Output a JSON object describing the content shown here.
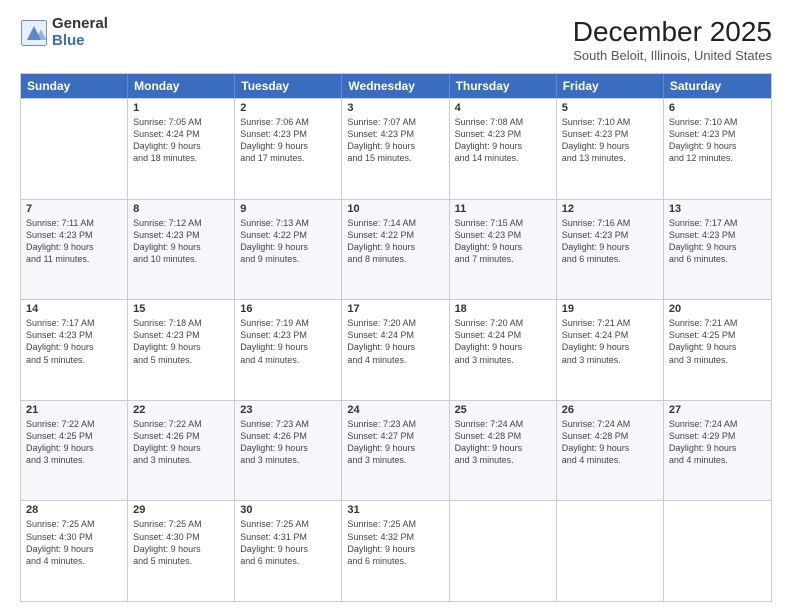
{
  "logo": {
    "general": "General",
    "blue": "Blue"
  },
  "title": "December 2025",
  "subtitle": "South Beloit, Illinois, United States",
  "header_days": [
    "Sunday",
    "Monday",
    "Tuesday",
    "Wednesday",
    "Thursday",
    "Friday",
    "Saturday"
  ],
  "rows": [
    [
      {
        "day": "",
        "info": ""
      },
      {
        "day": "1",
        "info": "Sunrise: 7:05 AM\nSunset: 4:24 PM\nDaylight: 9 hours\nand 18 minutes."
      },
      {
        "day": "2",
        "info": "Sunrise: 7:06 AM\nSunset: 4:23 PM\nDaylight: 9 hours\nand 17 minutes."
      },
      {
        "day": "3",
        "info": "Sunrise: 7:07 AM\nSunset: 4:23 PM\nDaylight: 9 hours\nand 15 minutes."
      },
      {
        "day": "4",
        "info": "Sunrise: 7:08 AM\nSunset: 4:23 PM\nDaylight: 9 hours\nand 14 minutes."
      },
      {
        "day": "5",
        "info": "Sunrise: 7:10 AM\nSunset: 4:23 PM\nDaylight: 9 hours\nand 13 minutes."
      },
      {
        "day": "6",
        "info": "Sunrise: 7:10 AM\nSunset: 4:23 PM\nDaylight: 9 hours\nand 12 minutes."
      }
    ],
    [
      {
        "day": "7",
        "info": "Sunrise: 7:11 AM\nSunset: 4:23 PM\nDaylight: 9 hours\nand 11 minutes."
      },
      {
        "day": "8",
        "info": "Sunrise: 7:12 AM\nSunset: 4:23 PM\nDaylight: 9 hours\nand 10 minutes."
      },
      {
        "day": "9",
        "info": "Sunrise: 7:13 AM\nSunset: 4:22 PM\nDaylight: 9 hours\nand 9 minutes."
      },
      {
        "day": "10",
        "info": "Sunrise: 7:14 AM\nSunset: 4:22 PM\nDaylight: 9 hours\nand 8 minutes."
      },
      {
        "day": "11",
        "info": "Sunrise: 7:15 AM\nSunset: 4:23 PM\nDaylight: 9 hours\nand 7 minutes."
      },
      {
        "day": "12",
        "info": "Sunrise: 7:16 AM\nSunset: 4:23 PM\nDaylight: 9 hours\nand 6 minutes."
      },
      {
        "day": "13",
        "info": "Sunrise: 7:17 AM\nSunset: 4:23 PM\nDaylight: 9 hours\nand 6 minutes."
      }
    ],
    [
      {
        "day": "14",
        "info": "Sunrise: 7:17 AM\nSunset: 4:23 PM\nDaylight: 9 hours\nand 5 minutes."
      },
      {
        "day": "15",
        "info": "Sunrise: 7:18 AM\nSunset: 4:23 PM\nDaylight: 9 hours\nand 5 minutes."
      },
      {
        "day": "16",
        "info": "Sunrise: 7:19 AM\nSunset: 4:23 PM\nDaylight: 9 hours\nand 4 minutes."
      },
      {
        "day": "17",
        "info": "Sunrise: 7:20 AM\nSunset: 4:24 PM\nDaylight: 9 hours\nand 4 minutes."
      },
      {
        "day": "18",
        "info": "Sunrise: 7:20 AM\nSunset: 4:24 PM\nDaylight: 9 hours\nand 3 minutes."
      },
      {
        "day": "19",
        "info": "Sunrise: 7:21 AM\nSunset: 4:24 PM\nDaylight: 9 hours\nand 3 minutes."
      },
      {
        "day": "20",
        "info": "Sunrise: 7:21 AM\nSunset: 4:25 PM\nDaylight: 9 hours\nand 3 minutes."
      }
    ],
    [
      {
        "day": "21",
        "info": "Sunrise: 7:22 AM\nSunset: 4:25 PM\nDaylight: 9 hours\nand 3 minutes."
      },
      {
        "day": "22",
        "info": "Sunrise: 7:22 AM\nSunset: 4:26 PM\nDaylight: 9 hours\nand 3 minutes."
      },
      {
        "day": "23",
        "info": "Sunrise: 7:23 AM\nSunset: 4:26 PM\nDaylight: 9 hours\nand 3 minutes."
      },
      {
        "day": "24",
        "info": "Sunrise: 7:23 AM\nSunset: 4:27 PM\nDaylight: 9 hours\nand 3 minutes."
      },
      {
        "day": "25",
        "info": "Sunrise: 7:24 AM\nSunset: 4:28 PM\nDaylight: 9 hours\nand 3 minutes."
      },
      {
        "day": "26",
        "info": "Sunrise: 7:24 AM\nSunset: 4:28 PM\nDaylight: 9 hours\nand 4 minutes."
      },
      {
        "day": "27",
        "info": "Sunrise: 7:24 AM\nSunset: 4:29 PM\nDaylight: 9 hours\nand 4 minutes."
      }
    ],
    [
      {
        "day": "28",
        "info": "Sunrise: 7:25 AM\nSunset: 4:30 PM\nDaylight: 9 hours\nand 4 minutes."
      },
      {
        "day": "29",
        "info": "Sunrise: 7:25 AM\nSunset: 4:30 PM\nDaylight: 9 hours\nand 5 minutes."
      },
      {
        "day": "30",
        "info": "Sunrise: 7:25 AM\nSunset: 4:31 PM\nDaylight: 9 hours\nand 6 minutes."
      },
      {
        "day": "31",
        "info": "Sunrise: 7:25 AM\nSunset: 4:32 PM\nDaylight: 9 hours\nand 6 minutes."
      },
      {
        "day": "",
        "info": ""
      },
      {
        "day": "",
        "info": ""
      },
      {
        "day": "",
        "info": ""
      }
    ]
  ]
}
